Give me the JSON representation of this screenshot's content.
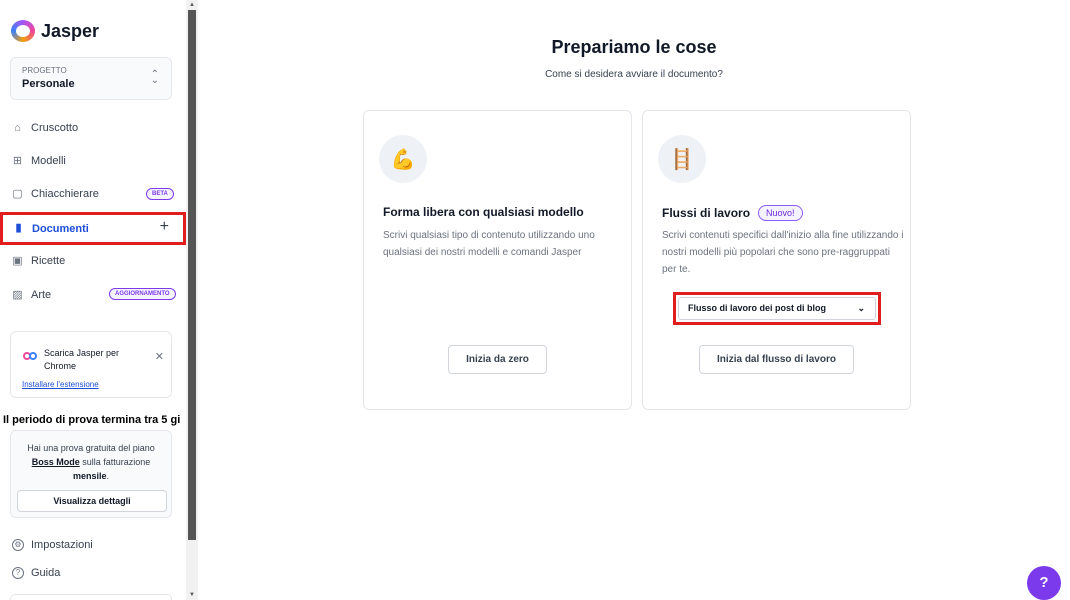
{
  "app": {
    "name": "Jasper"
  },
  "project": {
    "label": "PROGETTO",
    "value": "Personale"
  },
  "nav": [
    {
      "label": "Cruscotto",
      "icon": "home-icon"
    },
    {
      "label": "Modelli",
      "icon": "grid-icon"
    },
    {
      "label": "Chiacchierare",
      "icon": "chat-icon",
      "badge": "BETA"
    },
    {
      "label": "Documenti",
      "icon": "document-icon",
      "active": true
    },
    {
      "label": "Ricette",
      "icon": "terminal-icon"
    },
    {
      "label": "Arte",
      "icon": "image-icon",
      "badge": "AGGIORNAMENTO"
    }
  ],
  "extension": {
    "text": "Scarica Jasper per Chrome",
    "link": "Installare l'estensione"
  },
  "trial": {
    "title": "Il periodo di prova termina tra 5 gi",
    "line1": "Hai una prova gratuita del piano",
    "plan": "Boss Mode",
    "line2": " sulla fatturazione",
    "period": "mensile",
    "period_suffix": ".",
    "button": "Visualizza dettagli"
  },
  "footer_nav": [
    {
      "label": "Impostazioni",
      "icon": "gear-icon"
    },
    {
      "label": "Guida",
      "icon": "question-icon"
    }
  ],
  "main": {
    "title": "Prepariamo le cose",
    "subtitle": "Come si desidera avviare il documento?",
    "cards": [
      {
        "title": "Forma libera con qualsiasi modello",
        "description": "Scrivi qualsiasi tipo di contenuto utilizzando uno qualsiasi dei nostri modelli e comandi Jasper",
        "button": "Inizia da zero",
        "icon": "flexed-arm-icon"
      },
      {
        "title": "Flussi di lavoro",
        "badge": "Nuovo!",
        "description": "Scrivi contenuti specifici dall'inizio alla fine utilizzando i nostri modelli più popolari che sono pre-raggruppati per te.",
        "select_value": "Flusso di lavoro dei post di blog",
        "button": "Inizia dal flusso di lavoro",
        "icon": "ladder-icon"
      }
    ]
  },
  "help": {
    "label": "?"
  },
  "colors": {
    "accent": "#1d4ed8",
    "purple": "#7c3aed",
    "highlight": "#e11d1d"
  }
}
